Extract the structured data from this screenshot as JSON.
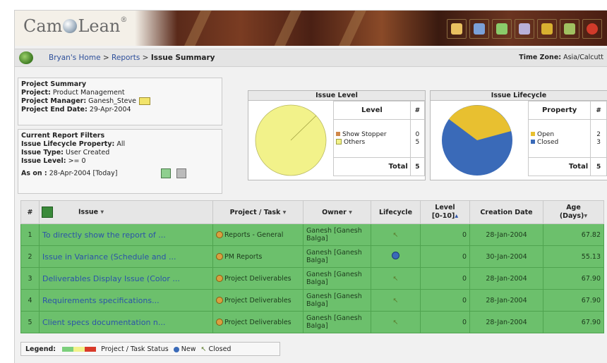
{
  "banner": {
    "logo_left": "Cam",
    "logo_right": "Lean",
    "logo_tm": "®",
    "tools": [
      {
        "icon": "user-icon",
        "color": "#e8c060"
      },
      {
        "icon": "globe-icon",
        "color": "#7aa0d8"
      },
      {
        "icon": "diamond-icon",
        "color": "#8acb6a"
      },
      {
        "icon": "people-icon",
        "color": "#b8b0d8"
      },
      {
        "icon": "chain-icon",
        "color": "#d8b030"
      },
      {
        "icon": "tools-icon",
        "color": "#a0c060"
      },
      {
        "icon": "power-icon",
        "color": "#d03a2a"
      }
    ]
  },
  "breadcrumb": {
    "home": "Bryan's Home",
    "sep": ">",
    "reports": "Reports",
    "current": "Issue Summary",
    "tz_label": "Time Zone:",
    "tz_value": "Asia/Calcutt"
  },
  "project_summary": {
    "heading": "Project Summary",
    "project_label": "Project:",
    "project_value": "Product Management",
    "manager_label": "Project Manager:",
    "manager_value": "Ganesh_Steve",
    "end_label": "Project End Date:",
    "end_value": "29-Apr-2004"
  },
  "filters": {
    "heading": "Current Report Filters",
    "lifecycle_label": "Issue Lifecycle Property:",
    "lifecycle_value": "All",
    "type_label": "Issue Type:",
    "type_value": "User Created",
    "level_label": "Issue Level:",
    "level_value": ">= 0",
    "ason_label": "As on :",
    "ason_value": "28-Apr-2004 [Today]"
  },
  "issue_level": {
    "title": "Issue Level",
    "col_level": "Level",
    "col_count": "#",
    "rows": [
      {
        "label": "Show Stopper",
        "count": "0",
        "color": "#d0884a"
      },
      {
        "label": "Others",
        "count": "5",
        "color": "#f2f28a"
      }
    ],
    "total_label": "Total",
    "total_value": "5",
    "pie_color": "#f2f28a"
  },
  "issue_lifecycle": {
    "title": "Issue Lifecycle",
    "col_property": "Property",
    "col_count": "#",
    "rows": [
      {
        "label": "Open",
        "count": "2",
        "color": "#e8c030"
      },
      {
        "label": "Closed",
        "count": "3",
        "color": "#3a6ab8"
      }
    ],
    "total_label": "Total",
    "total_value": "5"
  },
  "table": {
    "headers": {
      "num": "#",
      "issue": "Issue",
      "project": "Project / Task",
      "owner": "Owner",
      "lifecycle": "Lifecycle",
      "level": "Level",
      "level_range": "[0-10]",
      "created": "Creation Date",
      "age": "Age",
      "age_unit": "(Days)"
    },
    "rows": [
      {
        "num": "1",
        "issue": "To directly show the report of ...",
        "project": "Reports - General",
        "owner": "Ganesh [Ganesh Balga]",
        "lifecycle": "closed",
        "level": "0",
        "created": "28-Jan-2004",
        "age": "67.82"
      },
      {
        "num": "2",
        "issue": "Issue in Variance (Schedule and ...",
        "project": "PM Reports",
        "owner": "Ganesh [Ganesh Balga]",
        "lifecycle": "new",
        "level": "0",
        "created": "30-Jan-2004",
        "age": "55.13"
      },
      {
        "num": "3",
        "issue": "Deliverables Display Issue (Color ...",
        "project": "Project Deliverables",
        "owner": "Ganesh [Ganesh Balga]",
        "lifecycle": "closed",
        "level": "0",
        "created": "28-Jan-2004",
        "age": "67.90"
      },
      {
        "num": "4",
        "issue": "Requirements specifications...",
        "project": "Project Deliverables",
        "owner": "Ganesh [Ganesh Balga]",
        "lifecycle": "closed",
        "level": "0",
        "created": "28-Jan-2004",
        "age": "67.90"
      },
      {
        "num": "5",
        "issue": "Client specs documentation n...",
        "project": "Project Deliverables",
        "owner": "Ganesh [Ganesh Balga]",
        "lifecycle": "closed",
        "level": "0",
        "created": "28-Jan-2004",
        "age": "67.90"
      }
    ]
  },
  "legend": {
    "label": "Legend:",
    "status_text": "Project / Task Status",
    "new_text": "New",
    "closed_text": "Closed",
    "colors": [
      "#7ccf7c",
      "#f2f28a",
      "#d83a2a"
    ]
  }
}
